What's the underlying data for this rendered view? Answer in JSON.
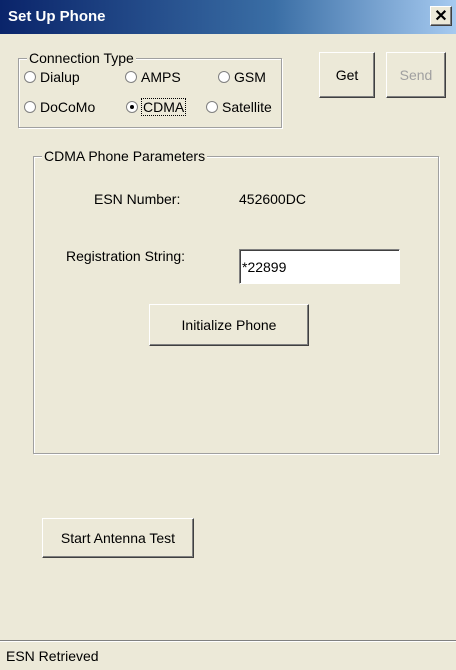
{
  "window": {
    "title": "Set Up Phone",
    "close_glyph": "✕"
  },
  "connection_type": {
    "label": "Connection Type",
    "options": [
      {
        "label": "Dialup",
        "checked": false
      },
      {
        "label": "AMPS",
        "checked": false
      },
      {
        "label": "GSM",
        "checked": false
      },
      {
        "label": "DoCoMo",
        "checked": false
      },
      {
        "label": "CDMA",
        "checked": true
      },
      {
        "label": "Satellite",
        "checked": false
      }
    ]
  },
  "buttons": {
    "get": "Get",
    "send": "Send",
    "initialize": "Initialize Phone",
    "antenna_test": "Start Antenna Test"
  },
  "cdma_params": {
    "label": "CDMA Phone Parameters",
    "esn_label": "ESN Number:",
    "esn_value": "452600DC",
    "registration_label": "Registration String:",
    "registration_value": "*22899"
  },
  "status": {
    "text": "ESN Retrieved"
  },
  "colors": {
    "face": "#ece9d8",
    "title_start": "#0a246a",
    "title_end": "#a6caf0"
  }
}
